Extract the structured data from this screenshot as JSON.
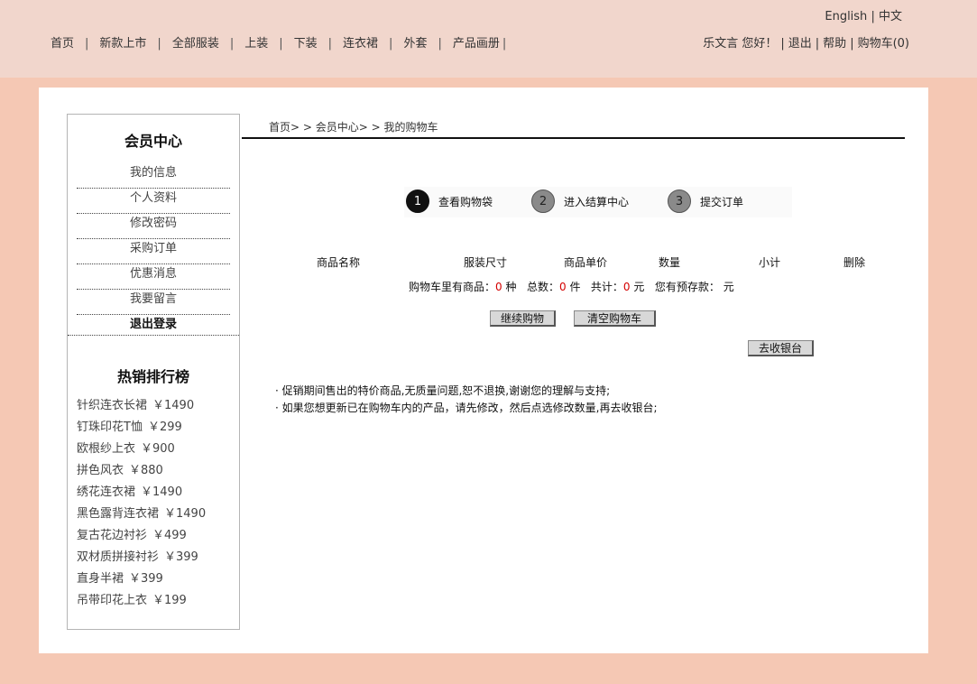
{
  "header": {
    "lang": {
      "english": "English",
      "divider": "|",
      "chinese": "中文"
    },
    "nav": [
      "首页",
      "新款上市",
      "全部服装",
      "上装",
      "下装",
      "连衣裙",
      "外套",
      "产品画册"
    ],
    "nav_separator": "|",
    "user": {
      "greeting": "乐文言 您好！",
      "logout": "退出",
      "help": "帮助",
      "cart": "购物车(0)",
      "divider": "|"
    }
  },
  "sidebar": {
    "member_title": "会员中心",
    "menu": [
      "我的信息",
      "个人资料",
      "修改密码",
      "采购订单",
      "优惠消息",
      "我要留言",
      "退出登录"
    ],
    "hot_title": "热销排行榜",
    "hot_items": [
      {
        "name": "针织连衣长裙",
        "price": "￥1490"
      },
      {
        "name": "钉珠印花T恤",
        "price": "￥299"
      },
      {
        "name": "欧根纱上衣",
        "price": "￥900"
      },
      {
        "name": "拼色风衣",
        "price": "￥880"
      },
      {
        "name": "绣花连衣裙",
        "price": "￥1490"
      },
      {
        "name": "黑色露背连衣裙",
        "price": "￥1490"
      },
      {
        "name": "复古花边衬衫",
        "price": "￥499"
      },
      {
        "name": "双材质拼接衬衫",
        "price": "￥399"
      },
      {
        "name": "直身半裙",
        "price": "￥399"
      },
      {
        "name": "吊带印花上衣",
        "price": "￥199"
      }
    ]
  },
  "breadcrumb": "首页> > 会员中心> > 我的购物车",
  "steps": [
    {
      "num": "1",
      "label": "查看购物袋"
    },
    {
      "num": "2",
      "label": "进入结算中心"
    },
    {
      "num": "3",
      "label": "提交订单"
    }
  ],
  "table_headers": [
    "商品名称",
    "服装尺寸",
    "商品单价",
    "数量",
    "小计",
    "删除"
  ],
  "summary": {
    "prefix": "购物车里有商品：",
    "kinds": "0",
    "kinds_unit": "种",
    "total_label": "总数：",
    "total": "0",
    "total_unit": "件",
    "sum_label": "共计：",
    "sum": "0",
    "sum_unit": "元",
    "deposit_label": "您有预存款：",
    "deposit_unit": "元"
  },
  "buttons": {
    "continue": "继续购物",
    "clear": "清空购物车",
    "checkout": "去收银台"
  },
  "notes": [
    "· 促销期间售出的特价商品,无质量问题,恕不退换,谢谢您的理解与支持;",
    "· 如果您想更新已在购物车内的产品，请先修改，然后点选修改数量,再去收银台;"
  ]
}
